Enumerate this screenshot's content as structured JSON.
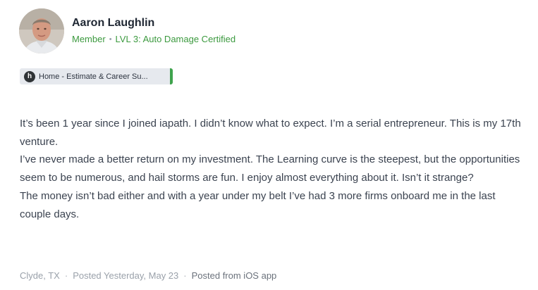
{
  "author": {
    "name": "Aaron Laughlin",
    "role": "Member",
    "level": "LVL 3: Auto Damage Certified"
  },
  "group": {
    "icon_letter": "h",
    "label": "Home - Estimate & Career Su..."
  },
  "post": {
    "paragraphs": [
      "It’s been 1 year since I joined iapath. I didn’t know what to expect. I’m a serial entrepreneur. This is my 17th venture.",
      "I’ve never made a better return on my investment. The Learning curve is the steepest, but the opportunities seem to be numerous, and hail storms are fun. I enjoy almost everything about it. Isn’t it strange?",
      "The money isn’t bad either and with a year under my belt I’ve had 3 more firms onboard me in the last couple days."
    ]
  },
  "footer": {
    "location": "Clyde, TX",
    "posted": "Posted Yesterday, May 23",
    "source": "Posted from iOS app",
    "separator": "·"
  },
  "colors": {
    "meta_green": "#3c9a3f",
    "chip_accent": "#3fa34d",
    "chip_bg": "#e6e9ee"
  }
}
